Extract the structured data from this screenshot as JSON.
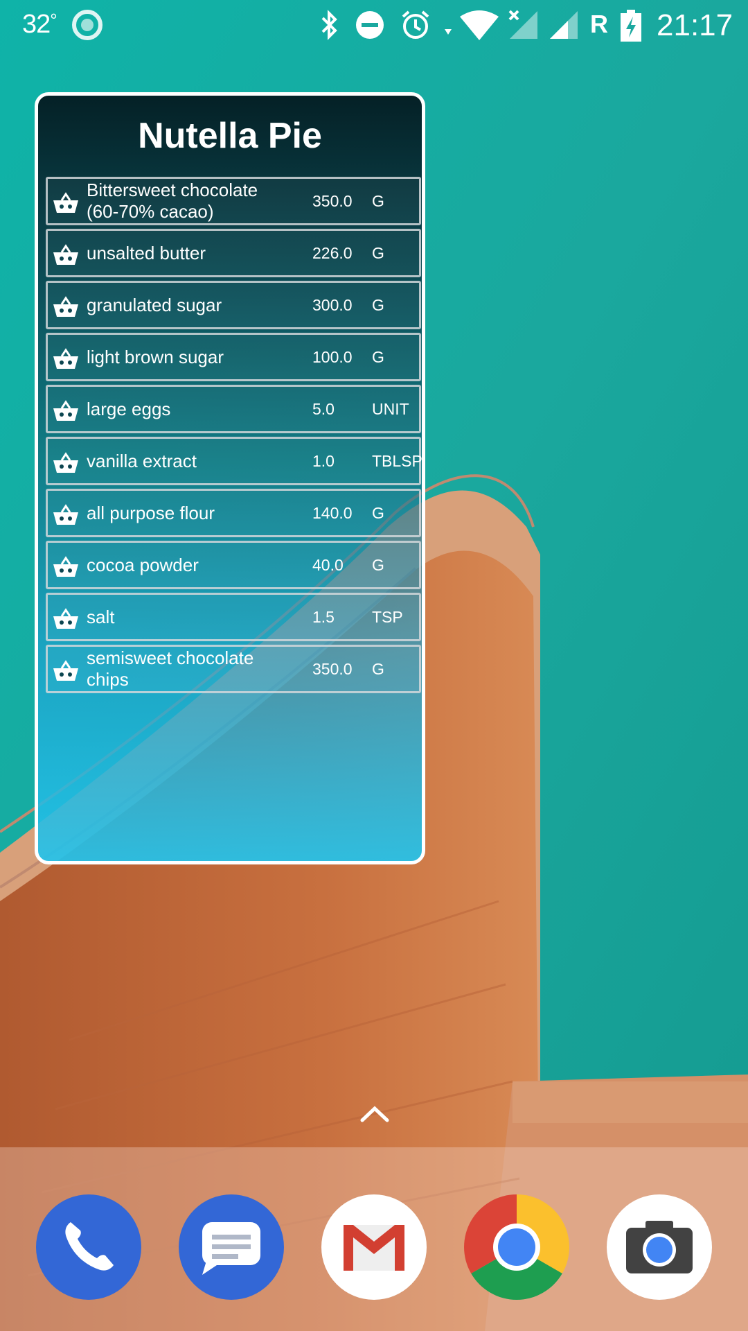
{
  "status_bar": {
    "temperature": "32",
    "temperature_unit": "°",
    "roaming_indicator": "R",
    "time": "21:17",
    "icons": [
      "weather-icon",
      "bluetooth-icon",
      "do-not-disturb-icon",
      "alarm-icon",
      "wifi-icon",
      "signal-no-sim-icon",
      "signal-icon",
      "battery-charging-icon"
    ]
  },
  "widget": {
    "title": "Nutella Pie",
    "ingredients": [
      {
        "name": "Bittersweet chocolate (60-70% cacao)",
        "quantity": "350.0",
        "unit": "G"
      },
      {
        "name": "unsalted butter",
        "quantity": "226.0",
        "unit": "G"
      },
      {
        "name": "granulated sugar",
        "quantity": "300.0",
        "unit": "G"
      },
      {
        "name": "light brown sugar",
        "quantity": "100.0",
        "unit": "G"
      },
      {
        "name": "large eggs",
        "quantity": "5.0",
        "unit": "UNIT"
      },
      {
        "name": "vanilla extract",
        "quantity": "1.0",
        "unit": "TBLSP"
      },
      {
        "name": "all purpose flour",
        "quantity": "140.0",
        "unit": "G"
      },
      {
        "name": "cocoa powder",
        "quantity": "40.0",
        "unit": "G"
      },
      {
        "name": "salt",
        "quantity": "1.5",
        "unit": "TSP"
      },
      {
        "name": "semisweet chocolate chips",
        "quantity": "350.0",
        "unit": "G"
      }
    ],
    "row_icon": "shopping-basket-icon"
  },
  "launcher": {
    "app_drawer_icon": "chevron-up-icon",
    "dock_apps": [
      "phone-app-icon",
      "messages-app-icon",
      "gmail-app-icon",
      "chrome-app-icon",
      "camera-app-icon"
    ]
  },
  "colors": {
    "water": "#1aa89f",
    "tower": "#c46a3c",
    "widget_border": "#ffffff"
  }
}
